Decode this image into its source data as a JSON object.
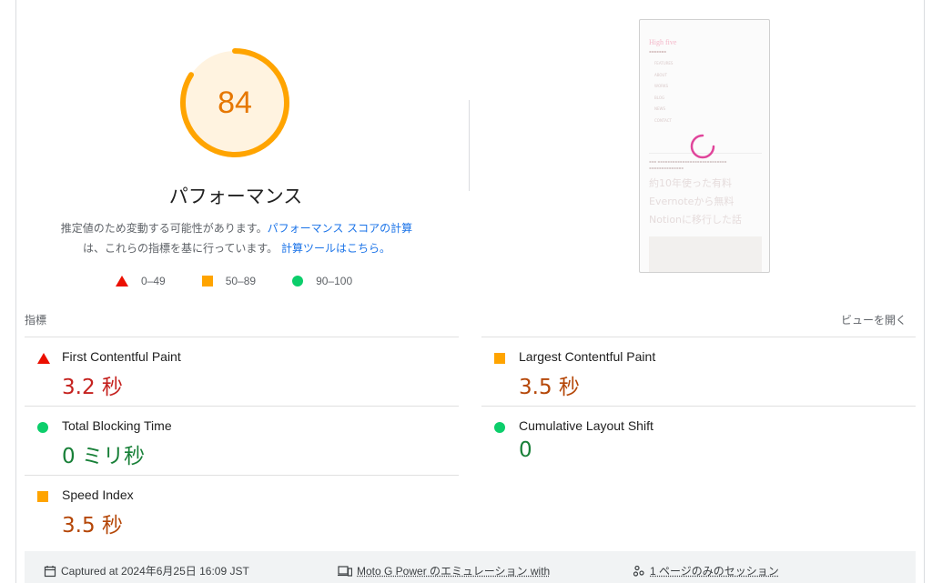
{
  "performance": {
    "score": "84",
    "score_fraction": 0.84,
    "title": "パフォーマンス",
    "description_prefix": "推定値のため変動する可能性があります。",
    "description_link1": "パフォーマンス スコアの計算",
    "description_middle": "は、これらの指標を基に行っています。",
    "description_link2": "計算ツールはこちら。",
    "accent_color": "#ffa400"
  },
  "legend": [
    {
      "shape": "triangle",
      "range": "0–49",
      "color": "#eb0f00"
    },
    {
      "shape": "square",
      "range": "50–89",
      "color": "#ffa400"
    },
    {
      "shape": "circle",
      "range": "90–100",
      "color": "#0cce6b"
    }
  ],
  "thumbnail": {
    "site_name": "High five",
    "menu_items": [
      "FEATURES",
      "ABOUT",
      "WORKS",
      "BLOG",
      "NEWS",
      "CONTACT"
    ],
    "headline_lines": [
      "約10年使った有料",
      "Evernoteから無料",
      "Notionに移行した話"
    ]
  },
  "metrics_section": {
    "label": "指標",
    "expand_label": "ビューを開く"
  },
  "metrics": [
    {
      "title": "First Contentful Paint",
      "value": "3.2 秒",
      "status": "fail",
      "icon": "red-triangle-icon"
    },
    {
      "title": "Largest Contentful Paint",
      "value": "3.5 秒",
      "status": "average",
      "icon": "orange-square-icon"
    },
    {
      "title": "Total Blocking Time",
      "value": "0 ミリ秒",
      "status": "pass",
      "icon": "green-circle-icon"
    },
    {
      "title": "Cumulative Layout Shift",
      "value": "0",
      "status": "pass",
      "icon": "green-circle-icon"
    },
    {
      "title": "Speed Index",
      "value": "3.5 秒",
      "status": "average",
      "icon": "orange-square-icon"
    }
  ],
  "footer": {
    "captured": "Captured at 2024年6月25日 16:09 JST",
    "device": "Moto G Power のエミュレーション with",
    "session": "1 ページのみのセッション",
    "icons": [
      "calendar-icon",
      "devices-icon",
      "session-icon"
    ]
  }
}
